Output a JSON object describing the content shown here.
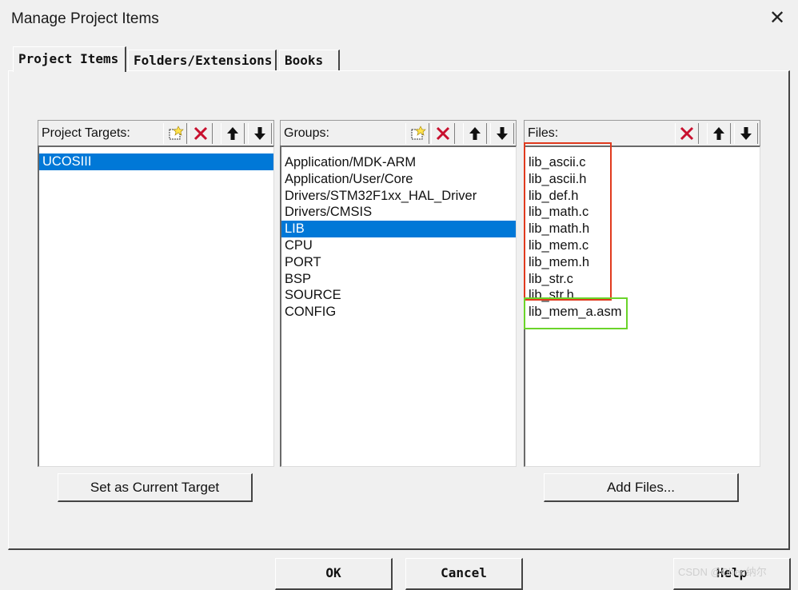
{
  "window": {
    "title": "Manage Project Items",
    "close_glyph": "✕"
  },
  "tabs": [
    {
      "label": "Project Items",
      "active": true
    },
    {
      "label": "Folders/Extensions",
      "active": false
    },
    {
      "label": "Books",
      "active": false
    }
  ],
  "targets": {
    "header": "Project Targets:",
    "items": [
      "UCOSIII"
    ],
    "selected_index": 0,
    "action_button": "Set as Current Target"
  },
  "groups": {
    "header": "Groups:",
    "items": [
      "Application/MDK-ARM",
      "Application/User/Core",
      "Drivers/STM32F1xx_HAL_Driver",
      "Drivers/CMSIS",
      "LIB",
      "CPU",
      "PORT",
      "BSP",
      "SOURCE",
      "CONFIG"
    ],
    "selected_index": 4
  },
  "files": {
    "header": "Files:",
    "items": [
      "lib_ascii.c",
      "lib_ascii.h",
      "lib_def.h",
      "lib_math.c",
      "lib_math.h",
      "lib_mem.c",
      "lib_mem.h",
      "lib_str.c",
      "lib_str.h",
      "lib_mem_a.asm"
    ],
    "action_button": "Add Files..."
  },
  "footer": {
    "ok": "OK",
    "cancel": "Cancel",
    "help": "Help"
  },
  "watermark": "CSDN @Chen纳尔",
  "colors": {
    "selection": "#0078d7",
    "highlight_red": "#e03a1e",
    "highlight_green": "#6ad42a",
    "delete_icon": "#c8102e"
  },
  "icons": [
    "new-icon",
    "delete-icon",
    "move-up-icon",
    "move-down-icon",
    "close-icon"
  ]
}
